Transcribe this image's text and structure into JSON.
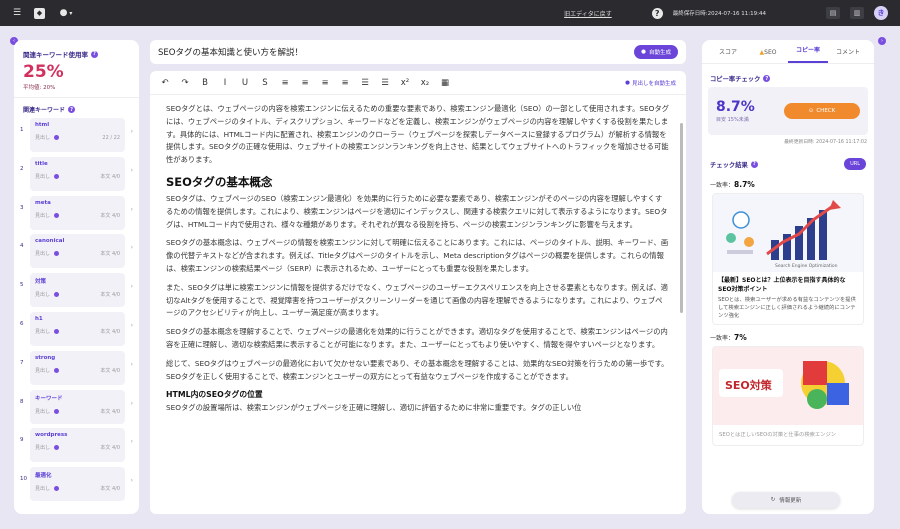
{
  "topbar": {
    "menu_icon": "☰",
    "logo_glyph": "◆",
    "logo2_glyph": "●",
    "caret": "▾",
    "old_editor_link": "旧エディタに戻す",
    "help_glyph": "?",
    "last_saved": "最終保存日時:2024-07-16 11:19:44",
    "avatar_initial": "き"
  },
  "left": {
    "usage_title": "関連キーワード使用率",
    "usage_pct": "25%",
    "usage_avg": "平均値: 20%",
    "keywords_title": "関連キーワード",
    "keywords": [
      {
        "num": "1",
        "name": "html",
        "status": "見出し",
        "count": "22 / 22"
      },
      {
        "num": "2",
        "name": "title",
        "status": "見出し",
        "count": "本文 4/0"
      },
      {
        "num": "3",
        "name": "meta",
        "status": "見出し",
        "count": "本文 4/0"
      },
      {
        "num": "4",
        "name": "canonical",
        "status": "見出し",
        "count": "本文 4/0"
      },
      {
        "num": "5",
        "name": "対策",
        "status": "見出し",
        "count": "本文 4/0"
      },
      {
        "num": "6",
        "name": "h1",
        "status": "見出し",
        "count": "本文 4/0"
      },
      {
        "num": "7",
        "name": "strong",
        "status": "見出し",
        "count": "本文 4/0"
      },
      {
        "num": "8",
        "name": "キーワード",
        "status": "見出し",
        "count": "本文 4/0"
      },
      {
        "num": "9",
        "name": "wordpress",
        "status": "見出し",
        "count": "本文 4/0"
      },
      {
        "num": "10",
        "name": "最適化",
        "status": "見出し",
        "count": "本文 4/0"
      }
    ]
  },
  "center": {
    "article_title": "SEOタグの基本知識と使い方を解説！",
    "ai_button": "自動生成",
    "toolbar_tools": [
      "↶",
      "↷",
      "B",
      "I",
      "U",
      "S",
      "≡",
      "≡",
      "≡",
      "≡",
      "☰",
      "☰",
      "x²",
      "x₂",
      "▦"
    ],
    "heading_auto": "見出しを自動生成",
    "paragraphs": [
      "SEOタグとは、ウェブページの内容を検索エンジンに伝えるための重要な要素であり、検索エンジン最適化（SEO）の一部として使用されます。SEOタグには、ウェブページのタイトル、ディスクリプション、キーワードなどを定義し、検索エンジンがウェブページの内容を理解しやすくする役割を果たします。具体的には、HTMLコード内に配置され、検索エンジンのクローラー（ウェブページを探索しデータベースに登録するプログラム）が解析する情報を提供します。SEOタグの正確な使用は、ウェブサイトの検索エンジンランキングを向上させ、結果としてウェブサイトへのトラフィックを増加させる可能性があります。"
    ],
    "h2_1": "SEOタグの基本概念",
    "paragraphs2": [
      "SEOタグは、ウェブページのSEO（検索エンジン最適化）を効果的に行うために必要な要素であり、検索エンジンがそのページの内容を理解しやすくするための情報を提供します。これにより、検索エンジンはページを適切にインデックスし、関連する検索クエリに対して表示するようになります。SEOタグは、HTMLコード内で使用され、様々な種類があります。それぞれが異なる役割を持ち、ページの検索エンジンランキングに影響を与えます。",
      "SEOタグの基本概念は、ウェブページの情報を検索エンジンに対して明確に伝えることにあります。これには、ページのタイトル、説明、キーワード、画像の代替テキストなどが含まれます。例えば、Titleタグはページのタイトルを示し、Meta descriptionタグはページの概要を提供します。これらの情報は、検索エンジンの検索結果ページ（SERP）に表示されるため、ユーザーにとっても重要な役割を果たします。",
      "また、SEOタグは単に検索エンジンに情報を提供するだけでなく、ウェブページのユーザーエクスペリエンスを向上させる要素ともなります。例えば、適切なAltタグを使用することで、視覚障害を持つユーザーがスクリーンリーダーを通じて画像の内容を理解できるようになります。これにより、ウェブページのアクセシビリティが向上し、ユーザー満足度が高まります。",
      "SEOタグの基本概念を理解することで、ウェブページの最適化を効果的に行うことができます。適切なタグを使用することで、検索エンジンはページの内容を正確に理解し、適切な検索結果に表示することが可能になります。また、ユーザーにとってもより使いやすく、情報を得やすいページとなります。",
      "総じて、SEOタグはウェブページの最適化において欠かせない要素であり、その基本概念を理解することは、効果的なSEO対策を行うための第一歩です。SEOタグを正しく使用することで、検索エンジンとユーザーの双方にとって有益なウェブページを作成することができます。"
    ],
    "h3_1": "HTML内のSEOタグの位置",
    "last_line": "SEOタグの設置場所は、検索エンジンがウェブページを正確に理解し、適切に評価するために非常に重要です。タグの正しい位"
  },
  "right": {
    "tabs": [
      "スコア",
      "SEO",
      "コピー率",
      "コメント"
    ],
    "copy_title": "コピー率チェック",
    "copy_pct": "8.7%",
    "copy_sub": "目安 15%未満",
    "check_button": "CHECK",
    "copy_date": "最終更新日時: 2024-07-16 11:17:02",
    "results_title": "チェック結果",
    "results_btn": "URL",
    "match1_label": "一致率：",
    "match1_value": "8.7%",
    "card1_img_text": "Search Engine Optimization",
    "card1_title": "【最新】SEOとは？上位表示を目指す具体的なSEO対策ポイント",
    "card1_desc": "SEOとは、検索ユーザーが求める有益なコンテンツを提供して検索エンジンに正しく評価されるよう継続的にコンテンツ強化",
    "match2_label": "一致率：",
    "match2_value": "7%",
    "card2_badge": "SEO対策",
    "card2_text": "SEOとは正しいSEOの対策と仕事の検索エンジン",
    "refresh_button": "情報更新"
  },
  "colors": {
    "accent": "#6b45d9",
    "pink": "#d1315f",
    "orange": "#f08a2c",
    "bg": "#e9e6f3"
  }
}
